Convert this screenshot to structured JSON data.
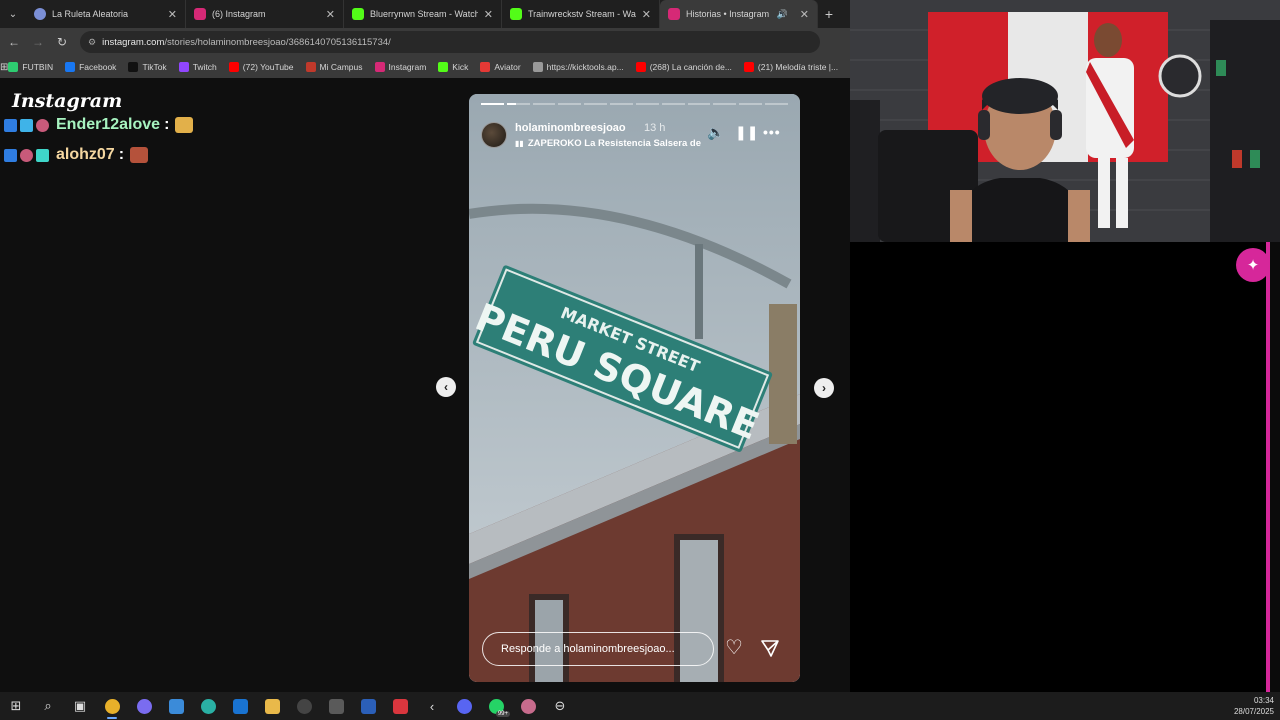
{
  "tabs": [
    {
      "title": "La Ruleta Aleatoria",
      "icon": "roulette-favicon",
      "color": "#7b8fd6"
    },
    {
      "title": "(6) Instagram",
      "icon": "instagram-favicon",
      "color": "#d62976"
    },
    {
      "title": "Bluerrynwn Stream - Watch Live...",
      "icon": "kick-favicon",
      "color": "#53fc18"
    },
    {
      "title": "Trainwreckstv Stream - Watch Li...",
      "icon": "kick-favicon",
      "color": "#53fc18"
    },
    {
      "title": "Historias • Instagram",
      "icon": "instagram-favicon",
      "color": "#d62976",
      "active": true
    }
  ],
  "address": {
    "host": "instagram.com",
    "path": "/stories/holaminombreesjoao/3686140705136115734/"
  },
  "bookmarks": [
    {
      "label": "FUTBIN",
      "color": "#2ecc71"
    },
    {
      "label": "Facebook",
      "color": "#1877f2"
    },
    {
      "label": "TikTok",
      "color": "#111111"
    },
    {
      "label": "Twitch",
      "color": "#9146ff"
    },
    {
      "label": "(72) YouTube",
      "color": "#ff0000"
    },
    {
      "label": "Mi Campus",
      "color": "#c0392b"
    },
    {
      "label": "Instagram",
      "color": "#d62976"
    },
    {
      "label": "Kick",
      "color": "#53fc18"
    },
    {
      "label": "Aviator",
      "color": "#e53935"
    },
    {
      "label": "https://kicktools.ap...",
      "color": "#999999"
    },
    {
      "label": "(268) La canción de...",
      "color": "#ff0000"
    },
    {
      "label": "(21) Melodía triste |...",
      "color": "#ff0000"
    }
  ],
  "overlay": {
    "title": "Instagram",
    "chat": [
      {
        "user": "Ender12alove",
        "color": "#a7f3c0",
        "emote_color": "#e2b04a"
      },
      {
        "user": "alohz07",
        "color": "#f5d7a0",
        "emote_color": "#b5523b"
      }
    ]
  },
  "story": {
    "username": "holaminombreesjoao",
    "time": "13 h",
    "music": "ZAPEROKO La Resistencia Salsera de",
    "progress_total": 12,
    "progress_current": 2,
    "reply_placeholder": "Responde a holaminombreesjoao...",
    "sign_top": "MARKET STREET",
    "sign_main": "PERU SQUARE"
  },
  "taskbar": {
    "badge": "99+",
    "time": "03:34",
    "date": "28/07/2025"
  }
}
